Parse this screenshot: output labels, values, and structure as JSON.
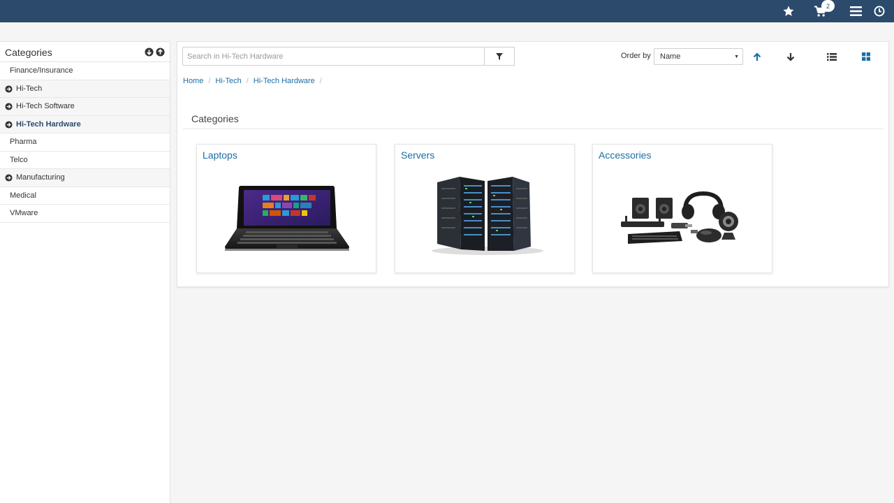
{
  "topbar": {
    "icons": [
      "star-icon",
      "cart-icon",
      "menu-icon",
      "clock-icon"
    ],
    "cart_count": "2",
    "color": "#2c4a6b"
  },
  "sidebar": {
    "title": "Categories",
    "items": [
      {
        "label": "Finance/Insurance",
        "expandable": false
      },
      {
        "label": "Hi-Tech",
        "expandable": true
      },
      {
        "label": "Hi-Tech Software",
        "expandable": true
      },
      {
        "label": "Hi-Tech Hardware",
        "expandable": true,
        "active": true
      },
      {
        "label": "Pharma",
        "expandable": false
      },
      {
        "label": "Telco",
        "expandable": false
      },
      {
        "label": "Manufacturing",
        "expandable": true
      },
      {
        "label": "Medical",
        "expandable": false
      },
      {
        "label": "VMware",
        "expandable": false
      }
    ]
  },
  "search": {
    "placeholder": "Search in Hi-Tech Hardware",
    "value": ""
  },
  "order": {
    "label": "Order by",
    "selected": "Name"
  },
  "breadcrumb": [
    "Home",
    "Hi-Tech",
    "Hi-Tech Hardware"
  ],
  "section": {
    "title": "Categories"
  },
  "cards": [
    {
      "title": "Laptops",
      "image": "laptop-image"
    },
    {
      "title": "Servers",
      "image": "servers-image"
    },
    {
      "title": "Accessories",
      "image": "accessories-image"
    }
  ],
  "colors": {
    "accent": "#1a6fa5",
    "topbar": "#2c4a6b"
  }
}
